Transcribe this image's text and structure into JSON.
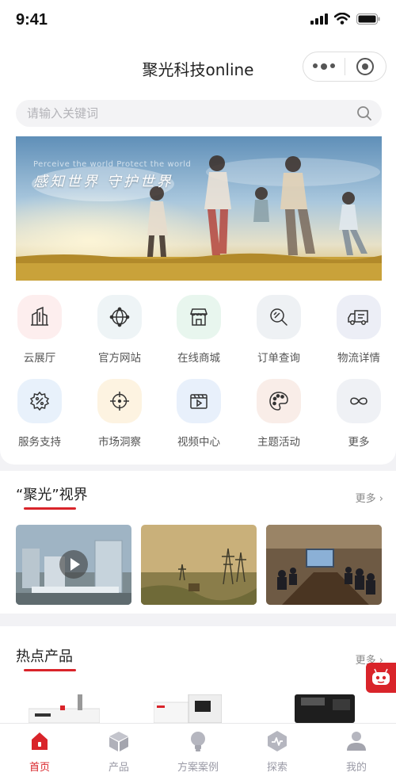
{
  "status": {
    "time": "9:41"
  },
  "header": {
    "title": "聚光科技online"
  },
  "search": {
    "placeholder": "请输入关键词"
  },
  "banner": {
    "caption_en": "Perceive the world   Protect the world",
    "caption_cn": "感知世界  守护世界"
  },
  "grid": [
    {
      "label": "云展厅",
      "icon": "buildings-icon",
      "bg": "#fdeeee"
    },
    {
      "label": "官方网站",
      "icon": "globe-icon",
      "bg": "#eef4f6"
    },
    {
      "label": "在线商城",
      "icon": "store-icon",
      "bg": "#e8f6ee"
    },
    {
      "label": "订单查询",
      "icon": "order-search-icon",
      "bg": "#eef1f4"
    },
    {
      "label": "物流详情",
      "icon": "truck-icon",
      "bg": "#eceef6"
    },
    {
      "label": "服务支持",
      "icon": "gear-icon",
      "bg": "#e8f1fb"
    },
    {
      "label": "市场洞察",
      "icon": "crosshair-icon",
      "bg": "#fdf3e1"
    },
    {
      "label": "视频中心",
      "icon": "video-icon",
      "bg": "#e8f0fb"
    },
    {
      "label": "主题活动",
      "icon": "palette-icon",
      "bg": "#f9ede8"
    },
    {
      "label": "更多",
      "icon": "infinity-icon",
      "bg": "#eff1f5"
    }
  ],
  "vision": {
    "title": "“聚光”视界",
    "more": "更多"
  },
  "hot": {
    "title": "热点产品",
    "more": "更多"
  },
  "tabs": [
    {
      "label": "首页",
      "icon": "home-icon",
      "active": true
    },
    {
      "label": "产品",
      "icon": "box-icon",
      "active": false
    },
    {
      "label": "方案案例",
      "icon": "bulb-icon",
      "active": false
    },
    {
      "label": "探索",
      "icon": "explore-icon",
      "active": false
    },
    {
      "label": "我的",
      "icon": "user-icon",
      "active": false
    }
  ],
  "colors": {
    "accent": "#d9242a",
    "icon_stroke": "#333333",
    "tab_inactive": "#9a9aa6"
  }
}
